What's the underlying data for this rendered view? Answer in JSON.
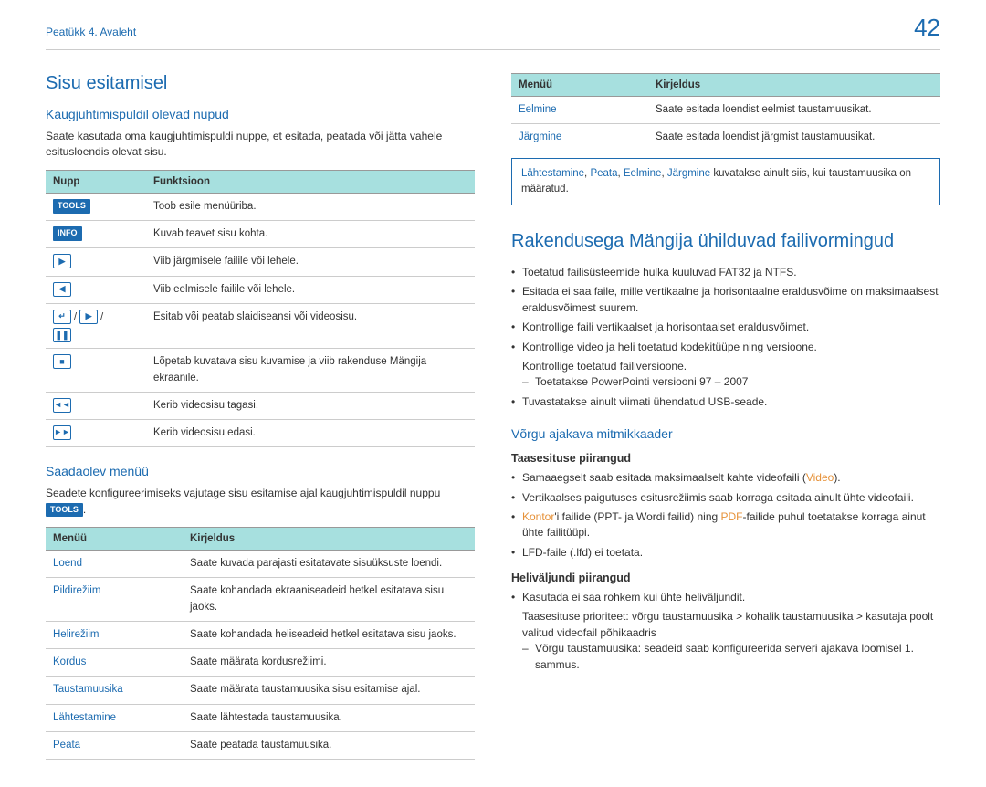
{
  "header": {
    "chapter": "Peatükk 4. Avaleht",
    "page": "42"
  },
  "left": {
    "h1": "Sisu esitamisel",
    "h2a": "Kaugjuhtimispuldil olevad nupud",
    "p1a": "Saate kasutada oma kaugjuhtimispuldi nuppe, et esitada, peatada või jätta vahele esitusloendis olevat sisu.",
    "table1": {
      "th1": "Nupp",
      "th2": "Funktsioon",
      "tools": "TOOLS",
      "tools_desc": "Toob esile menüüriba.",
      "info": "INFO",
      "info_desc": "Kuvab teavet sisu kohta.",
      "next": "▶",
      "next_desc": "Viib järgmisele failile või lehele.",
      "prev": "◀",
      "prev_desc": "Viib eelmisele failile või lehele.",
      "slide_desc": "Esitab või peatab slaidiseansi või videosisu.",
      "stop": "■",
      "stop_desc": "Lõpetab kuvatava sisu kuvamise ja viib rakenduse Mängija ekraanile.",
      "rew": "◄◄",
      "rew_desc": "Kerib videosisu tagasi.",
      "fwd": "►►",
      "fwd_desc": "Kerib videosisu edasi."
    },
    "h2b": "Saadaolev menüü",
    "p2_pre": "Seadete konfigureerimiseks vajutage sisu esitamise ajal kaugjuhtimispuldil nuppu ",
    "p2_badge": "TOOLS",
    "p2_suf": ".",
    "table2": {
      "th1": "Menüü",
      "th2": "Kirjeldus",
      "r": [
        {
          "m": "Loend",
          "d": "Saate kuvada parajasti esitatavate sisuüksuste loendi."
        },
        {
          "m": "Pildirežiim",
          "d": "Saate kohandada ekraaniseadeid hetkel esitatava sisu jaoks."
        },
        {
          "m": "Helirežiim",
          "d": "Saate kohandada heliseadeid hetkel esitatava sisu jaoks."
        },
        {
          "m": "Kordus",
          "d": "Saate määrata kordusrežiimi."
        },
        {
          "m": "Taustamuusika",
          "d": "Saate määrata taustamuusika sisu esitamise ajal."
        },
        {
          "m": "Lähtestamine",
          "d": "Saate lähtestada taustamuusika."
        },
        {
          "m": "Peata",
          "d": "Saate peatada taustamuusika."
        }
      ]
    }
  },
  "right": {
    "table3": {
      "th1": "Menüü",
      "th2": "Kirjeldus",
      "r": [
        {
          "m": "Eelmine",
          "d": "Saate esitada loendist eelmist taustamuusikat."
        },
        {
          "m": "Järgmine",
          "d": "Saate esitada loendist järgmist taustamuusikat."
        }
      ]
    },
    "note": {
      "a": "Lähtestamine",
      "b": "Peata",
      "c": "Eelmine",
      "d": "Järgmine",
      "suf": " kuvatakse ainult siis, kui taustamuusika on määratud."
    },
    "h1b": "Rakendusega Mängija ühilduvad failivormingud",
    "bullets1": [
      "Toetatud failisüsteemide hulka kuuluvad FAT32 ja NTFS.",
      "Esitada ei saa faile, mille vertikaalne ja horisontaalne eraldusvõime on maksimaalsest eraldusvõimest suurem.",
      "Kontrollige faili vertikaalset ja horisontaalset eraldusvõimet.",
      "Kontrollige video ja heli toetatud kodekitüüpe ning versioone.",
      "Kontrollige toetatud failiversioone."
    ],
    "sub1": "Toetatakse PowerPointi versiooni 97 – 2007",
    "bul_last": "Tuvastatakse ainult viimati ühendatud USB-seade.",
    "h2b": "Võrgu ajakava mitmikkaader",
    "h3a": "Taasesituse piirangud",
    "bullets2a_pre": "Samaaegselt saab esitada maksimaalselt kahte videofaili (",
    "bullets2a_link": "Video",
    "bullets2a_suf": ").",
    "bullets2b": "Vertikaalses paigutuses esitusrežiimis saab korraga esitada ainult ühte videofaili.",
    "bullets2c_a": "Kontor",
    "bullets2c_mid": "'i failide (PPT- ja Wordi failid) ning ",
    "bullets2c_b": "PDF",
    "bullets2c_suf": "-failide puhul toetatakse korraga ainut ühte failitüüpi.",
    "bullets2d": "LFD-faile (.lfd) ei toetata.",
    "h3b": "Heliväljundi piirangud",
    "bullets3": [
      "Kasutada ei saa rohkem kui ühte heliväljundit.",
      "Taasesituse prioriteet: võrgu taustamuusika > kohalik taustamuusika > kasutaja poolt valitud videofail põhikaadris"
    ],
    "sub3": "Võrgu taustamuusika: seadeid saab konfigureerida serveri ajakava loomisel 1. sammus."
  }
}
